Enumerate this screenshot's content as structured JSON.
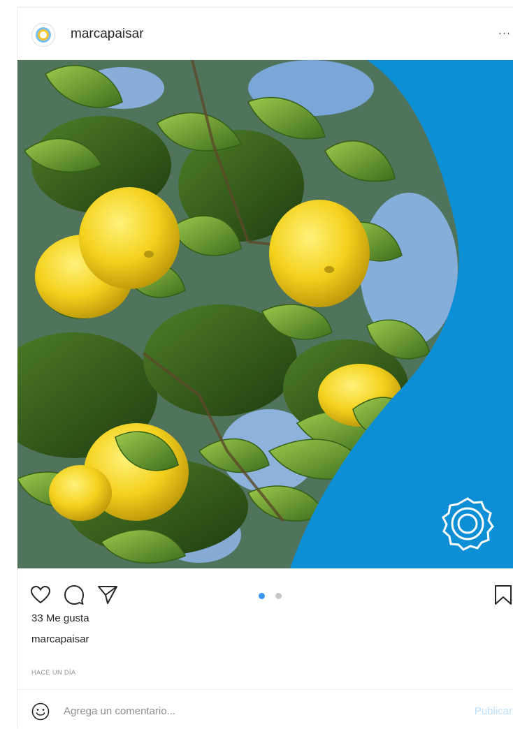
{
  "post": {
    "username": "marcapaisar",
    "more_label": "···",
    "likes": "33 Me gusta",
    "caption_user": "marcapaisar",
    "timestamp": "HACE UN DÍA"
  },
  "carousel": {
    "count": 2,
    "active_index": 0,
    "active_color": "#3897f0",
    "inactive_color": "#c7c7c7"
  },
  "comment": {
    "placeholder": "Agrega un comentario...",
    "publish_label": "Publicar"
  },
  "colors": {
    "brand_blue": "#0d8fd6",
    "text": "#262626",
    "muted": "#8e8e8e",
    "publish_disabled": "#b9dffc"
  },
  "icons": {
    "avatar": "sun-logo-icon",
    "like": "heart-icon",
    "comment": "comment-bubble-icon",
    "share": "paper-plane-icon",
    "save": "bookmark-icon",
    "emoji": "smiley-icon",
    "watermark": "sun-badge-icon"
  }
}
